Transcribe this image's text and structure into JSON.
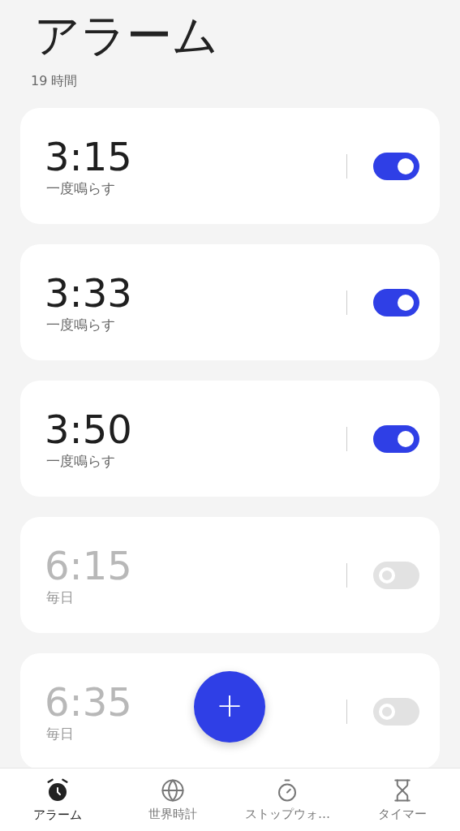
{
  "title": "アラーム",
  "subtitle": "19 時間",
  "alarms": [
    {
      "time": "3:15",
      "repeat": "一度鳴らす",
      "on": true
    },
    {
      "time": "3:33",
      "repeat": "一度鳴らす",
      "on": true
    },
    {
      "time": "3:50",
      "repeat": "一度鳴らす",
      "on": true
    },
    {
      "time": "6:15",
      "repeat": "毎日",
      "on": false
    },
    {
      "time": "6:35",
      "repeat": "毎日",
      "on": false
    }
  ],
  "add_button": {
    "label": "+"
  },
  "nav": [
    {
      "label": "アラーム",
      "kind": "alarm",
      "selected": true
    },
    {
      "label": "世界時計",
      "kind": "globe",
      "selected": false
    },
    {
      "label": "ストップウォ…",
      "kind": "stopwatch",
      "selected": false
    },
    {
      "label": "タイマー",
      "kind": "hourglass",
      "selected": false
    }
  ]
}
